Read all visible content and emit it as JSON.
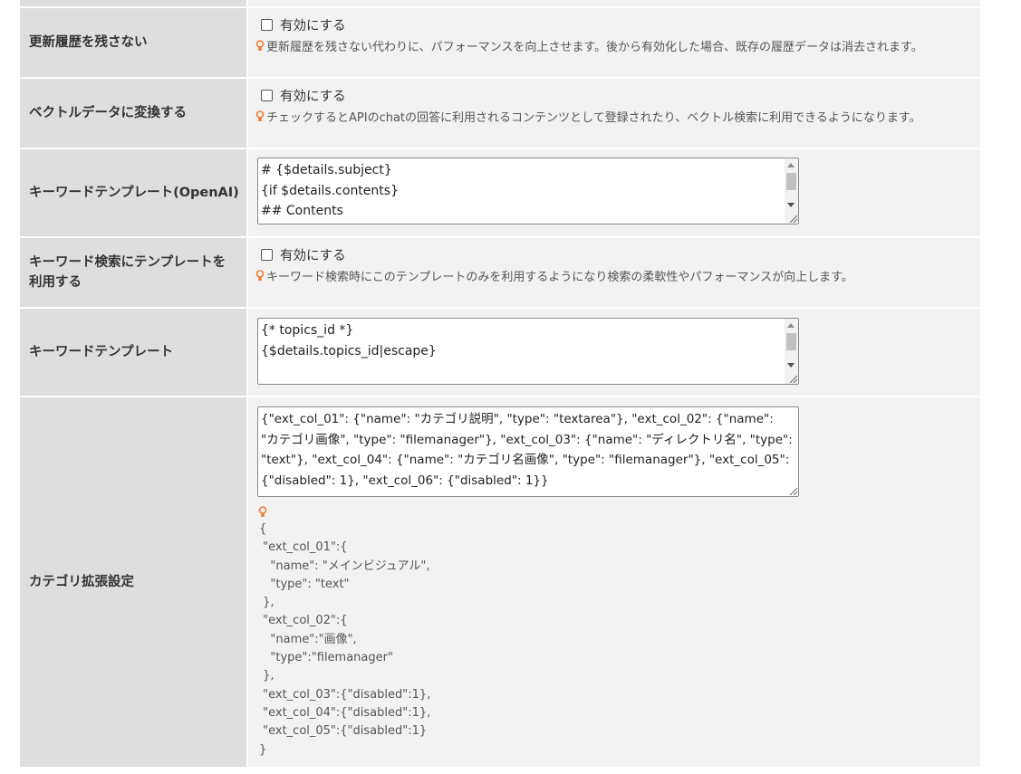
{
  "rows": {
    "no_history": {
      "label": "更新履歴を残さない",
      "checkbox_label": "有効にする",
      "hint": "更新履歴を残さない代わりに、パフォーマンスを向上させます。後から有効化した場合、既存の履歴データは消去されます。"
    },
    "vector": {
      "label": "ベクトルデータに変換する",
      "checkbox_label": "有効にする",
      "hint": "チェックするとAPIのchatの回答に利用されるコンテンツとして登録されたり、ベクトル検索に利用できるようになります。"
    },
    "keyword_openai": {
      "label": "キーワードテンプレート(OpenAI)",
      "lines": [
        "# {$details.subject}",
        "{if $details.contents}",
        "## Contents"
      ]
    },
    "keyword_search_template": {
      "label_line1": "キーワード検索にテンプレートを",
      "label_line2": "利用する",
      "checkbox_label": "有効にする",
      "hint": "キーワード検索時にこのテンプレートのみを利用するようになり検索の柔軟性やパフォーマンスが向上します。"
    },
    "keyword_template": {
      "label": "キーワードテンプレート",
      "lines": [
        "{* topics_id *}",
        "{$details.topics_id|escape}"
      ]
    },
    "category_ext": {
      "label": "カテゴリ拡張設定",
      "value": "{\"ext_col_01\": {\"name\": \"カテゴリ説明\", \"type\": \"textarea\"}, \"ext_col_02\": {\"name\": \"カテゴリ画像\", \"type\": \"filemanager\"}, \"ext_col_03\": {\"name\": \"ディレクトリ名\", \"type\": \"text\"}, \"ext_col_04\": {\"name\": \"カテゴリ名画像\", \"type\": \"filemanager\"}, \"ext_col_05\": {\"disabled\": 1}, \"ext_col_06\": {\"disabled\": 1}}",
      "example": "{\n \"ext_col_01\":{\n   \"name\": \"メインビジュアル\",\n   \"type\": \"text\"\n },\n \"ext_col_02\":{\n   \"name\":\"画像\",\n   \"type\":\"filemanager\"\n },\n \"ext_col_03\":{\"disabled\":1},\n \"ext_col_04\":{\"disabled\":1},\n \"ext_col_05\":{\"disabled\":1}\n}"
    }
  },
  "colors": {
    "label_bg": "#dedede",
    "field_bg": "#f2f2f2",
    "hint_icon": "#f0793a"
  },
  "icons": [
    "lightbulb-icon",
    "resize-grip-icon"
  ]
}
